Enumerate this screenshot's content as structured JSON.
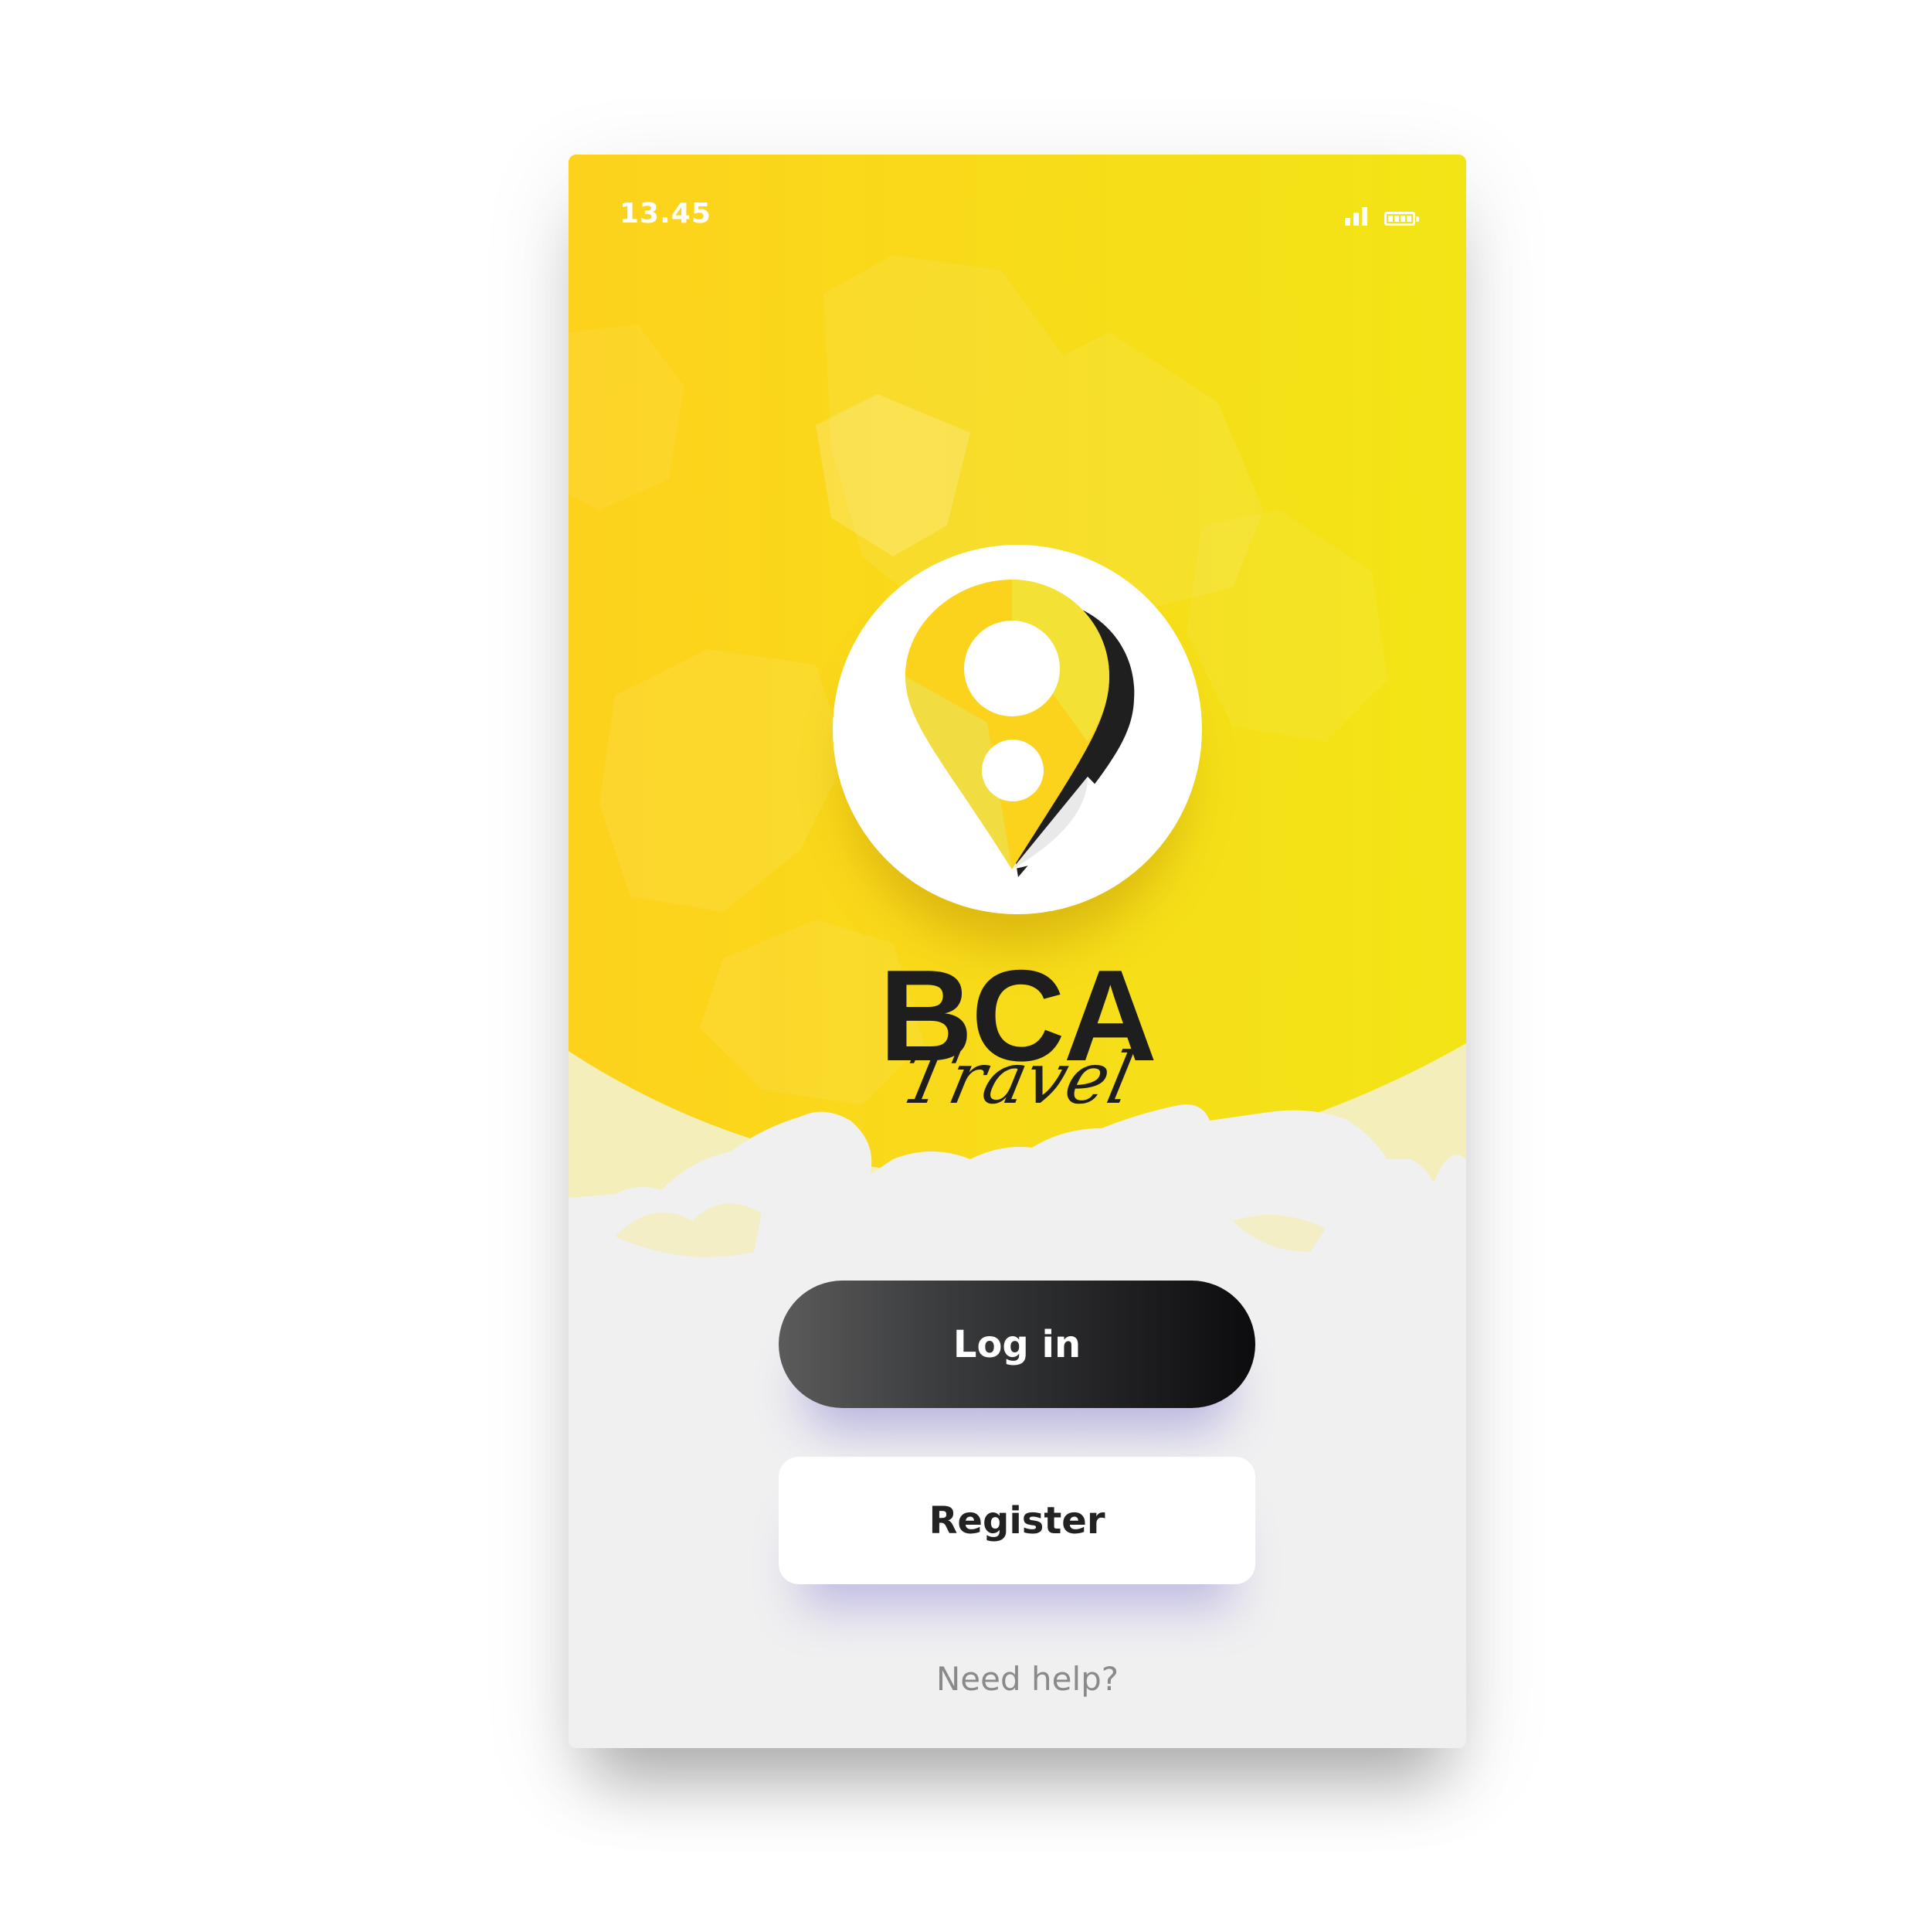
{
  "status_bar": {
    "time": "13.45",
    "signal_icon": "signal-bars-icon",
    "battery_icon": "battery-full-icon"
  },
  "brand": {
    "name": "BCA",
    "tagline": "Travel",
    "logo_icon": "map-pin-icon"
  },
  "actions": {
    "login_label": "Log in",
    "register_label": "Register",
    "help_label": "Need help?"
  },
  "colors": {
    "hero_yellow_left": "#fdd21c",
    "hero_yellow_right": "#f2e516",
    "login_button_dark": "#0c0c0e",
    "register_button": "#ffffff",
    "screen_background": "#f0f0f1",
    "help_text": "#8a8a8a"
  }
}
